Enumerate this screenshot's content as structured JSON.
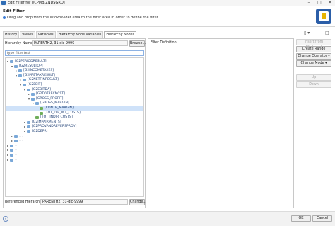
{
  "window": {
    "title": "Edit Filter for [/CPMB/ZNDSGRQ]",
    "minimize": "–",
    "maximize": "□",
    "close": "✕"
  },
  "banner": {
    "heading": "Edit Filter",
    "message": "Drag and drop from the InfoProvider area to the filter area in order to define the filter",
    "logo_icon": "sap-bpc-logo"
  },
  "tabs": [
    {
      "label": "History"
    },
    {
      "label": "Values"
    },
    {
      "label": "Variables"
    },
    {
      "label": "Hierarchy Node Variables"
    },
    {
      "label": "Hierarchy Nodes",
      "active": true
    }
  ],
  "toolbar": {
    "view_menu": "▯ ▾",
    "minimize": "–",
    "maximize": "□"
  },
  "hierarchy": {
    "name_label": "Hierarchy Name:",
    "name_value": "PARENTH2, 31-dic-9999",
    "browse_label": "Browse...",
    "filter_placeholder": "type filter text"
  },
  "tree": [
    {
      "label": "[G2PERIODRESULT]",
      "level": 0,
      "expanded": true
    },
    {
      "label": "[G2RESULTOP]",
      "level": 1,
      "expanded": true
    },
    {
      "label": "[G2INCOMETAXES]",
      "level": 2,
      "expanded": false
    },
    {
      "label": "[G2PRETAXRESULT]",
      "level": 2,
      "expanded": true
    },
    {
      "label": "[G2NETFINRESULT]",
      "level": 3,
      "expanded": false
    },
    {
      "label": "[G2EBIT]",
      "level": 3,
      "expanded": true
    },
    {
      "label": "[G2EBITDA]",
      "level": 4,
      "expanded": true
    },
    {
      "label": "[G2TOTRECNCST]",
      "level": 5,
      "expanded": false
    },
    {
      "label": "[GROSS_PROFIT]",
      "level": 5,
      "expanded": true
    },
    {
      "label": "[GROSS_MARGIN]",
      "level": 6,
      "expanded": true
    },
    {
      "label": "[CONTR_MARGIN]",
      "level": 7,
      "leaf": true,
      "selected": true
    },
    {
      "label": "[TOT_DIR_INT_COSTS]",
      "level": 7,
      "leaf": true
    },
    {
      "label": "[TOT_INDIR_COSTS]",
      "level": 6,
      "leaf": true
    },
    {
      "label": "[G2IMPAIRMENTS]",
      "level": 4,
      "expanded": false
    },
    {
      "label": "[G2PROVANDREVERSPROV]",
      "level": 4,
      "expanded": false
    },
    {
      "label": "[G2DEPR]",
      "level": 4,
      "expanded": false
    },
    {
      "label": "...",
      "level": 1,
      "expanded": false,
      "blur": true
    },
    {
      "label": "...",
      "level": 1,
      "expanded": false,
      "blur": true
    },
    {
      "label": "...",
      "level": 0,
      "expanded": false,
      "blur": true
    },
    {
      "label": "...",
      "level": 0,
      "expanded": false,
      "blur": true
    },
    {
      "label": "...",
      "level": 0,
      "expanded": false,
      "blur": true
    },
    {
      "label": "...",
      "level": 0,
      "expanded": false,
      "blur": true
    }
  ],
  "referenced": {
    "label": "Referenced Hierarchy:",
    "value": "PARENTH2, 31-dic-9999",
    "change_label": "Change..."
  },
  "filter_definition": {
    "title": "Filter Definition"
  },
  "side_buttons": {
    "insert_clipboard": "Insert from Clipboard",
    "create_range": "Create Range",
    "change_operator": "Change Operator ▾",
    "change_mode": "Change Mode ▾",
    "up": "Up",
    "down": "Down"
  },
  "footer": {
    "help": "?",
    "ok": "OK",
    "cancel": "Cancel"
  }
}
